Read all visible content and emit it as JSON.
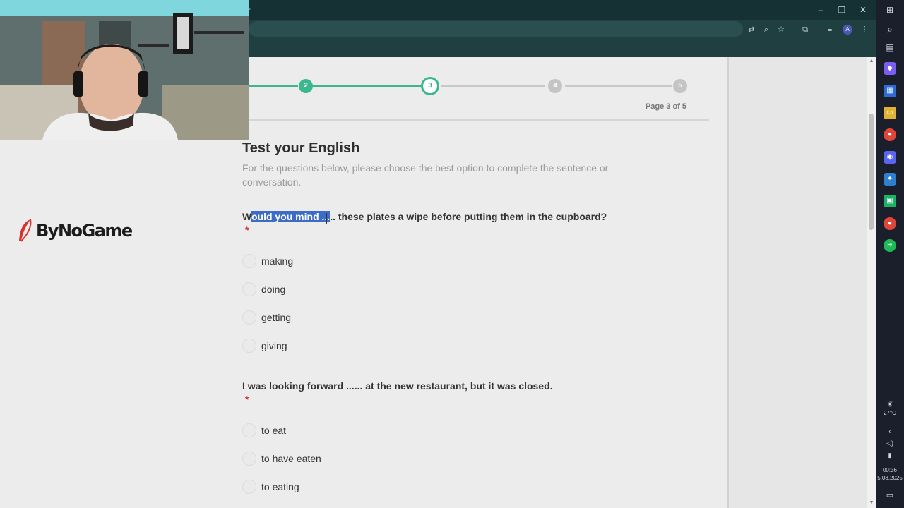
{
  "browser": {
    "new_tab_icon": "plus-icon",
    "window_controls": [
      "minimize-icon",
      "restore-icon",
      "close-icon"
    ],
    "toolbar_icons": [
      "translate-icon",
      "zoom-icon",
      "star-icon",
      "extensions-icon",
      "media-icon"
    ],
    "avatar_initial": "A"
  },
  "progress": {
    "steps": [
      "2",
      "3",
      "4",
      "5"
    ],
    "current_step": 3,
    "page_label": "Page 3 of 5",
    "accent": "#3ab88c"
  },
  "form": {
    "title": "Test your English",
    "subtitle": "For the questions below, please choose the best option to complete the sentence or conversation.",
    "questions": [
      {
        "text_highlighted": "ould you mind ...",
        "text_prefix": "W",
        "text_rest": ".. these plates a wipe before putting them in the cupboard?",
        "required_mark": "*",
        "options": [
          "making",
          "doing",
          "getting",
          "giving"
        ]
      },
      {
        "text": "I was looking forward ...... at the new restaurant, but it was closed.",
        "required_mark": "*",
        "options": [
          "to eat",
          "to have eaten",
          "to eating"
        ]
      }
    ]
  },
  "logo": {
    "text": "ByNoGame",
    "brand_color": "#d9322c"
  },
  "taskbar": {
    "weather_temp": "27°C",
    "time": "00:36",
    "date": "5.08.2025"
  }
}
